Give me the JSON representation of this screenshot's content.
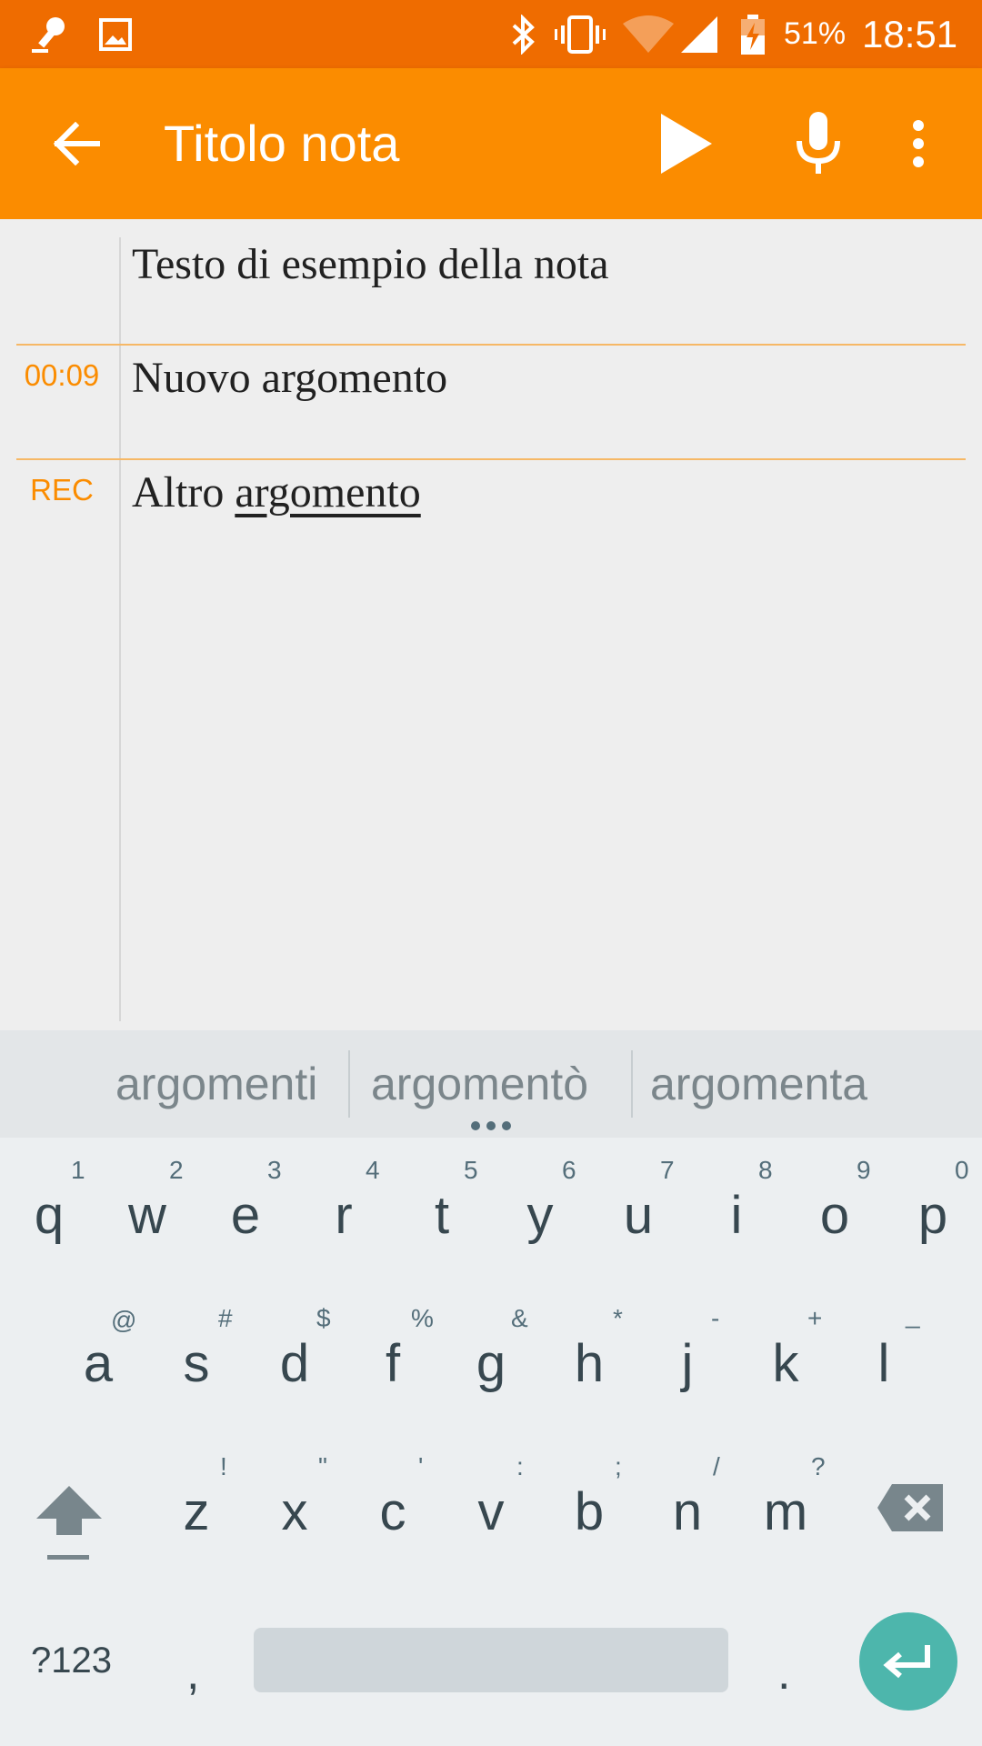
{
  "status_bar": {
    "battery_percent": "51%",
    "time": "18:51",
    "icons": [
      "microphone-notification-icon",
      "image-notification-icon",
      "bluetooth-icon",
      "vibrate-icon",
      "wifi-icon",
      "cellular-signal-icon",
      "battery-charging-icon"
    ]
  },
  "app_bar": {
    "title": "Titolo nota",
    "actions": [
      "back-arrow-icon",
      "play-icon",
      "microphone-icon",
      "more-options-icon"
    ]
  },
  "note": {
    "rows": [
      {
        "label": "",
        "text": "Testo di esempio della nota"
      },
      {
        "label": "00:09",
        "text": "Nuovo argomento"
      },
      {
        "label": "REC",
        "text_plain": "Altro ",
        "text_underlined": "argomento"
      }
    ]
  },
  "keyboard": {
    "suggestions": [
      "argomenti",
      "argomentò",
      "argomenta"
    ],
    "row1": [
      {
        "key": "q",
        "hint": "1"
      },
      {
        "key": "w",
        "hint": "2"
      },
      {
        "key": "e",
        "hint": "3"
      },
      {
        "key": "r",
        "hint": "4"
      },
      {
        "key": "t",
        "hint": "5"
      },
      {
        "key": "y",
        "hint": "6"
      },
      {
        "key": "u",
        "hint": "7"
      },
      {
        "key": "i",
        "hint": "8"
      },
      {
        "key": "o",
        "hint": "9"
      },
      {
        "key": "p",
        "hint": "0"
      }
    ],
    "row2": [
      {
        "key": "a",
        "hint": "@"
      },
      {
        "key": "s",
        "hint": "#"
      },
      {
        "key": "d",
        "hint": "$"
      },
      {
        "key": "f",
        "hint": "%"
      },
      {
        "key": "g",
        "hint": "&"
      },
      {
        "key": "h",
        "hint": "*"
      },
      {
        "key": "j",
        "hint": "-"
      },
      {
        "key": "k",
        "hint": "+"
      },
      {
        "key": "l",
        "hint": "_"
      }
    ],
    "row3": [
      {
        "key": "z",
        "hint": "!"
      },
      {
        "key": "x",
        "hint": "\""
      },
      {
        "key": "c",
        "hint": "'"
      },
      {
        "key": "v",
        "hint": ":"
      },
      {
        "key": "b",
        "hint": ";"
      },
      {
        "key": "n",
        "hint": "/"
      },
      {
        "key": "m",
        "hint": "?"
      }
    ],
    "symbols_key": "?123",
    "comma_key": ",",
    "period_key": ".",
    "accent_color": "#4db6ac"
  },
  "colors": {
    "status_bar": "#ef6c00",
    "app_bar": "#fb8c00",
    "label_orange": "#fb8c00"
  }
}
